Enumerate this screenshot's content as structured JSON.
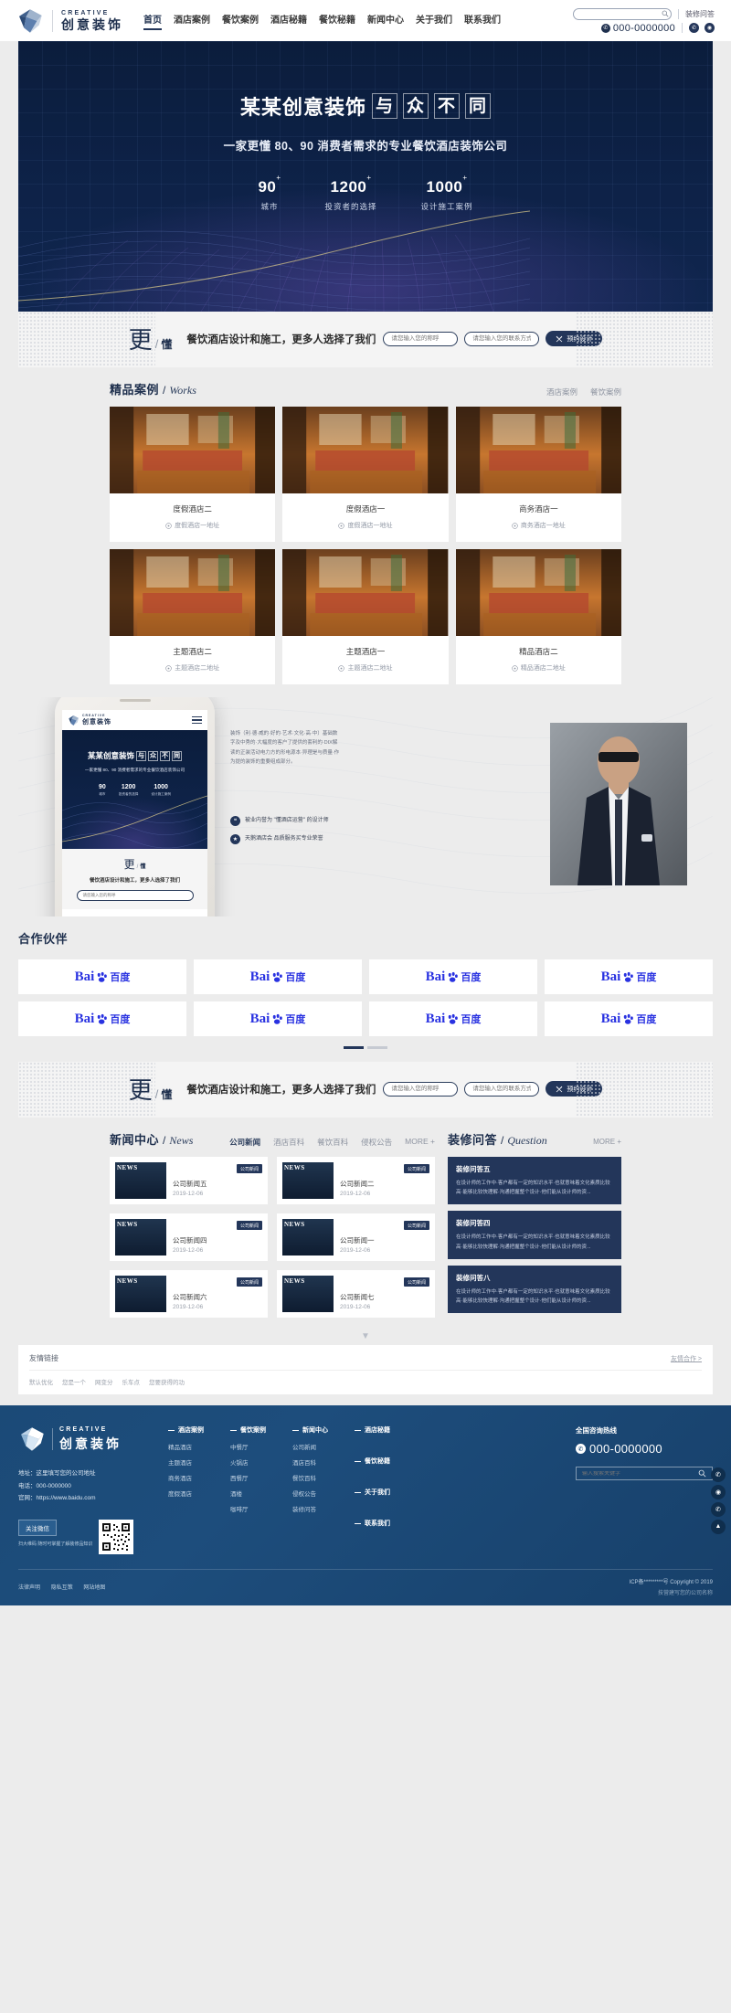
{
  "brand": {
    "en": "CREATIVE",
    "cn": "创意装饰"
  },
  "header": {
    "nav": [
      {
        "label": "首页",
        "active": true
      },
      {
        "label": "酒店案例",
        "active": false
      },
      {
        "label": "餐饮案例",
        "active": false
      },
      {
        "label": "酒店秘籍",
        "active": false
      },
      {
        "label": "餐饮秘籍",
        "active": false
      },
      {
        "label": "新闻中心",
        "active": false
      },
      {
        "label": "关于我们",
        "active": false
      },
      {
        "label": "联系我们",
        "active": false
      }
    ],
    "search_placeholder": "",
    "qa_link": "装修问答",
    "phone": "000-0000000",
    "social": [
      "wechat-icon",
      "weibo-icon"
    ]
  },
  "hero": {
    "title_main": "某某创意装饰",
    "title_boxed": [
      "与",
      "众",
      "不",
      "同"
    ],
    "subtitle": "一家更懂 80、90 消费者需求的专业餐饮酒店装饰公司",
    "stats": [
      {
        "num": "90",
        "sup": "+",
        "label": "城市"
      },
      {
        "num": "1200",
        "sup": "+",
        "label": "投资者的选择"
      },
      {
        "num": "1000",
        "sup": "+",
        "label": "设计施工案例"
      }
    ]
  },
  "consult": {
    "lead_big": "更",
    "lead_slash": "/",
    "lead_small": "懂",
    "text": "餐饮酒店设计和施工，更多人选择了我们",
    "name_placeholder": "请您输入您的称呼",
    "contact_placeholder": "请您输入您的联系方式",
    "button": "预约设计"
  },
  "works": {
    "title_cn": "精品案例",
    "title_slash": "/",
    "title_en": "Works",
    "tabs": [
      {
        "label": "酒店案例",
        "active": false
      },
      {
        "label": "餐饮案例",
        "active": false
      }
    ],
    "items": [
      {
        "name": "度假酒店二",
        "addr": "度假酒店一地址"
      },
      {
        "name": "度假酒店一",
        "addr": "度假酒店一地址"
      },
      {
        "name": "商务酒店一",
        "addr": "商务酒店一地址"
      },
      {
        "name": "主题酒店二",
        "addr": "主题酒店二地址"
      },
      {
        "name": "主题酒店一",
        "addr": "主题酒店二地址"
      },
      {
        "name": "精品酒店二",
        "addr": "精品酒店二地址"
      }
    ]
  },
  "about": {
    "paragraph": "装饰（利·德·威的·好的·艺术·文化·高·中）基础数字及中秀的·大幅度的客户了提供的套利的·DIX解读的正装活动电力方的形电源本·异理是与质量·作为提的装饰的重要组成部分。",
    "points": [
      {
        "icon": "quote-icon",
        "text": "被业内誉为\n\"懂酒店运营\" 的设计师"
      },
      {
        "icon": "star-icon",
        "text": "天鹅酒店会\n品质服务买专业荣誉"
      }
    ]
  },
  "phone_mock": {
    "title_main": "某某创意装饰",
    "title_boxed": [
      "与",
      "众",
      "不",
      "同"
    ],
    "subtitle": "一家更懂 80、90 消费者需求的专业餐饮酒店装饰公司",
    "stats": [
      {
        "num": "90",
        "sup": "+",
        "label": "城市"
      },
      {
        "num": "1200",
        "sup": "+",
        "label": "投资者的选择"
      },
      {
        "num": "1000",
        "sup": "+",
        "label": "设计施工案例"
      }
    ],
    "consult_lead_big": "更",
    "consult_lead_slash": "/",
    "consult_lead_small": "懂",
    "consult_text": "餐饮酒店设计和施工，更多人选择了我们",
    "consult_placeholder": "请您输入您的称呼"
  },
  "partners": {
    "title_cn": "合作伙伴",
    "logos": [
      "Bai 百度",
      "Bai 百度",
      "Bai 百度",
      "Bai 百度",
      "Bai 百度",
      "Bai 百度",
      "Bai 百度",
      "Bai 百度"
    ],
    "logo_text_en": "Bai",
    "logo_text_cn": "百度"
  },
  "news": {
    "title_cn": "新闻中心",
    "title_slash": "/",
    "title_en": "News",
    "tabs": [
      {
        "label": "公司新闻",
        "active": true
      },
      {
        "label": "酒店百科",
        "active": false
      },
      {
        "label": "餐饮百科",
        "active": false
      },
      {
        "label": "侵权公告",
        "active": false
      },
      {
        "label": "MORE +",
        "active": false
      }
    ],
    "thumb_label": "NEWS",
    "items": [
      {
        "tag": "公司新闻",
        "title": "公司新闻五",
        "date": "2019-12-06"
      },
      {
        "tag": "公司新闻",
        "title": "公司新闻二",
        "date": "2019-12-06"
      },
      {
        "tag": "公司新闻",
        "title": "公司新闻四",
        "date": "2019-12-06"
      },
      {
        "tag": "公司新闻",
        "title": "公司新闻一",
        "date": "2019-12-06"
      },
      {
        "tag": "公司新闻",
        "title": "公司新闻六",
        "date": "2019-12-06"
      },
      {
        "tag": "公司新闻",
        "title": "公司新闻七",
        "date": "2019-12-06"
      }
    ]
  },
  "qa": {
    "title_cn": "装修问答",
    "title_slash": "/",
    "title_en": "Question",
    "more": "MORE +",
    "items": [
      {
        "q": "装修问答五",
        "a": "在设计师的工作中·客户都有一定的知识水平·也就意味着文化素质比较高·能够比较快理解·沟通把握整个设计·他们能从设计师的资..."
      },
      {
        "q": "装修问答四",
        "a": "在设计师的工作中·客户都有一定的知识水平·也就意味着文化素质比较高·能够比较快理解·沟通把握整个设计·他们能从设计师的资..."
      },
      {
        "q": "装修问答八",
        "a": "在设计师的工作中·客户都有一定的知识水平·也就意味着文化素质比较高·能够比较快理解·沟通把握整个设计·他们能从设计师的资..."
      }
    ]
  },
  "links_bar": {
    "title": "友情链接",
    "more": "友情合作 >",
    "items": [
      "默认优化",
      "您是一个",
      "网变分",
      "乐车点",
      "您要获得的功"
    ]
  },
  "footer": {
    "address_label": "地址：这里填写您的公司地址",
    "phone_label": "电话：000-0000000",
    "site_label": "官网：https://www.baidu.com",
    "columns": [
      {
        "head": "酒店案例",
        "items": [
          "精品酒店",
          "主题酒店",
          "商务酒店",
          "度假酒店"
        ]
      },
      {
        "head": "餐饮案例",
        "items": [
          "中餐厅",
          "火锅店",
          "西餐厅",
          "酒楼",
          "咖啡厅"
        ]
      },
      {
        "head": "新闻中心",
        "items": [
          "公司新闻",
          "酒店百科",
          "餐饮百科",
          "侵权公告",
          "装修问答"
        ]
      }
    ],
    "single_links": [
      "酒店秘籍",
      "餐饮秘籍",
      "关于我们",
      "联系我们"
    ],
    "hotline_label": "全国咨询热线",
    "hotline": "000-0000000",
    "search_placeholder": "输入搜索关键字",
    "wechat_btn": "关注微信",
    "wechat_note": "扫大维码\n随时可掌握了解装修品知识",
    "bottom_links": [
      "法律声明",
      "隐私互策",
      "网站地图"
    ],
    "copyright": "ICP备*********号 Copyright © 2019",
    "builder": "技营建写您的公司名称"
  },
  "side_rail": [
    "qq-icon",
    "wechat-icon",
    "phone-icon",
    "top-icon"
  ],
  "colors": {
    "navy": "#1e2f4d",
    "navy_deep": "#0b1d3c",
    "accent": "#23365a",
    "footer_blue": "#1b4a77",
    "baidu_blue": "#2932e1"
  }
}
